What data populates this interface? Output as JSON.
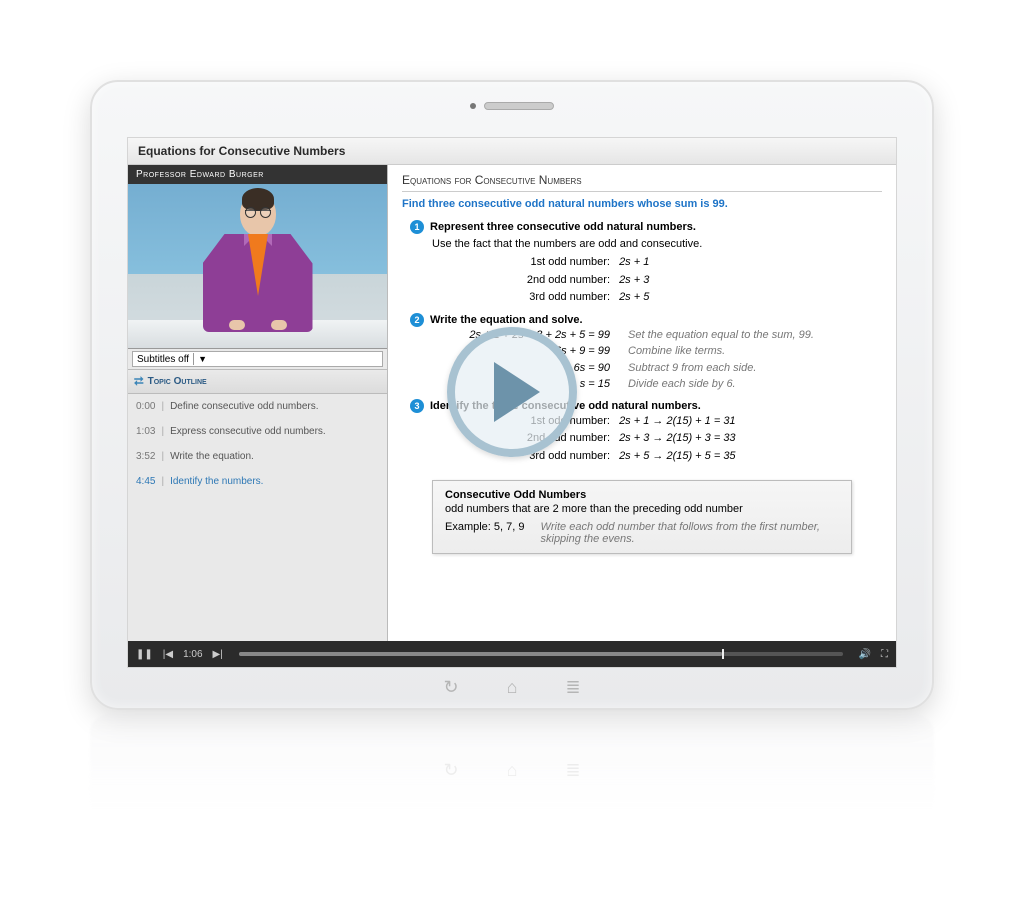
{
  "title": "Equations for Consecutive Numbers",
  "professor": "Professor Edward Burger",
  "subtitles": {
    "label": "Subtitles off"
  },
  "outline": {
    "header": "Topic Outline",
    "items": [
      {
        "time": "0:00",
        "label": "Define consecutive odd numbers."
      },
      {
        "time": "1:03",
        "label": "Express consecutive odd numbers."
      },
      {
        "time": "3:52",
        "label": "Write the equation."
      },
      {
        "time": "4:45",
        "label": "Identify the numbers."
      }
    ],
    "activeIndex": 3
  },
  "lesson": {
    "heading": "Equations for Consecutive Numbers",
    "prompt": "Find three consecutive odd natural numbers whose sum is 99.",
    "step1": {
      "title": "Represent three consecutive odd natural numbers.",
      "note": "Use the fact that the numbers are odd and consecutive.",
      "n1l": "1st odd number:",
      "n1v": "2s + 1",
      "n2l": "2nd odd number:",
      "n2v": "2s + 3",
      "n3l": "3rd odd number:",
      "n3v": "2s + 5"
    },
    "step2": {
      "title": "Write the equation and solve.",
      "r1e": "2s + 1 + 2s + 3 + 2s + 5 = 99",
      "r1n": "Set the equation equal to the sum, 99.",
      "r2e": "6s + 9 = 99",
      "r2n": "Combine like terms.",
      "r3e": "6s = 90",
      "r3n": "Subtract 9 from each side.",
      "r4e": "s = 15",
      "r4n": "Divide each side by 6."
    },
    "step3": {
      "title": "Identify the three consecutive odd natural numbers.",
      "n1l": "1st odd number:",
      "n1v": "2s + 1 → 2(15) + 1 = 31",
      "n2l": "2nd odd number:",
      "n2v": "2s + 3 → 2(15) + 3 = 33",
      "n3l": "3rd odd number:",
      "n3v": "2s + 5 → 2(15) + 5 = 35"
    },
    "definition": {
      "title": "Consecutive Odd Numbers",
      "body": "odd numbers that are 2 more than the preceding odd number",
      "exampleLabel": "Example:  5, 7, 9",
      "exampleNote": "Write each odd number that follows from the first number, skipping the evens."
    }
  },
  "player": {
    "time": "1:06"
  }
}
